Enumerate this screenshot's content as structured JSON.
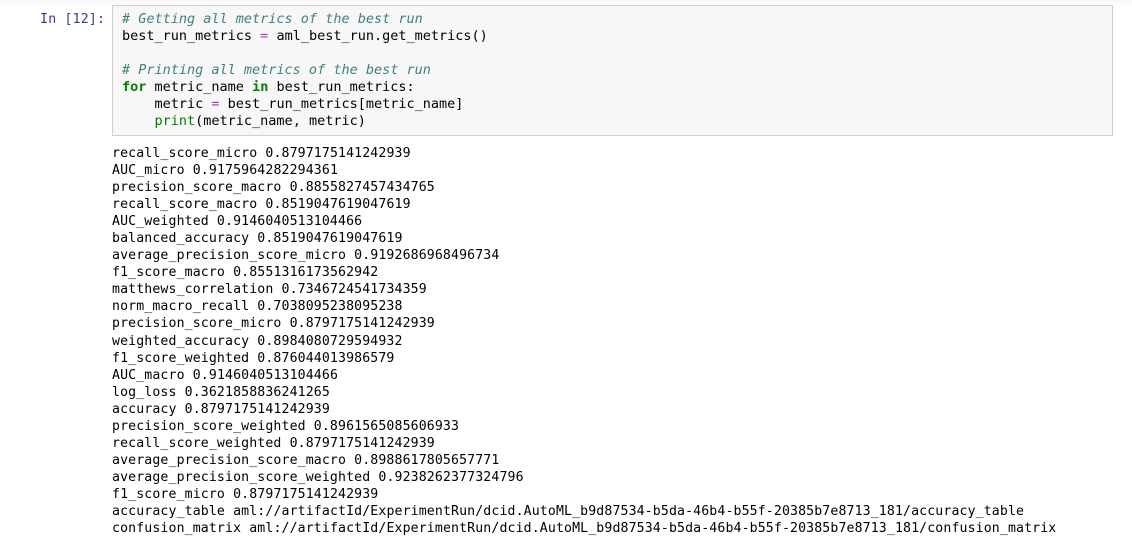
{
  "cell": {
    "prompt_label": "In [12]:",
    "code_lines": [
      [
        {
          "t": "comment",
          "s": "# Getting all metrics of the best run"
        }
      ],
      [
        {
          "t": "plain",
          "s": "best_run_metrics "
        },
        {
          "t": "operator",
          "s": "="
        },
        {
          "t": "plain",
          "s": " aml_best_run.get_metrics()"
        }
      ],
      [
        {
          "t": "plain",
          "s": ""
        }
      ],
      [
        {
          "t": "comment",
          "s": "# Printing all metrics of the best run"
        }
      ],
      [
        {
          "t": "keyword",
          "s": "for"
        },
        {
          "t": "plain",
          "s": " metric_name "
        },
        {
          "t": "keyword",
          "s": "in"
        },
        {
          "t": "plain",
          "s": " best_run_metrics:"
        }
      ],
      [
        {
          "t": "plain",
          "s": "    metric "
        },
        {
          "t": "operator",
          "s": "="
        },
        {
          "t": "plain",
          "s": " best_run_metrics[metric_name]"
        }
      ],
      [
        {
          "t": "plain",
          "s": "    "
        },
        {
          "t": "builtin",
          "s": "print"
        },
        {
          "t": "plain",
          "s": "(metric_name, metric)"
        }
      ]
    ]
  },
  "output": {
    "metrics": [
      {
        "name": "recall_score_micro",
        "value": "0.8797175141242939"
      },
      {
        "name": "AUC_micro",
        "value": "0.9175964282294361"
      },
      {
        "name": "precision_score_macro",
        "value": "0.8855827457434765"
      },
      {
        "name": "recall_score_macro",
        "value": "0.8519047619047619"
      },
      {
        "name": "AUC_weighted",
        "value": "0.9146040513104466"
      },
      {
        "name": "balanced_accuracy",
        "value": "0.8519047619047619"
      },
      {
        "name": "average_precision_score_micro",
        "value": "0.9192686968496734"
      },
      {
        "name": "f1_score_macro",
        "value": "0.8551316173562942"
      },
      {
        "name": "matthews_correlation",
        "value": "0.7346724541734359"
      },
      {
        "name": "norm_macro_recall",
        "value": "0.7038095238095238"
      },
      {
        "name": "precision_score_micro",
        "value": "0.8797175141242939"
      },
      {
        "name": "weighted_accuracy",
        "value": "0.8984080729594932"
      },
      {
        "name": "f1_score_weighted",
        "value": "0.876044013986579"
      },
      {
        "name": "AUC_macro",
        "value": "0.9146040513104466"
      },
      {
        "name": "log_loss",
        "value": "0.3621858836241265"
      },
      {
        "name": "accuracy",
        "value": "0.8797175141242939"
      },
      {
        "name": "precision_score_weighted",
        "value": "0.8961565085606933"
      },
      {
        "name": "recall_score_weighted",
        "value": "0.8797175141242939"
      },
      {
        "name": "average_precision_score_macro",
        "value": "0.8988617805657771"
      },
      {
        "name": "average_precision_score_weighted",
        "value": "0.9238262377324796"
      },
      {
        "name": "f1_score_micro",
        "value": "0.8797175141242939"
      },
      {
        "name": "accuracy_table",
        "value": "aml://artifactId/ExperimentRun/dcid.AutoML_b9d87534-b5da-46b4-b55f-20385b7e8713_181/accuracy_table"
      },
      {
        "name": "confusion_matrix",
        "value": "aml://artifactId/ExperimentRun/dcid.AutoML_b9d87534-b5da-46b4-b55f-20385b7e8713_181/confusion_matrix"
      }
    ]
  },
  "colors": {
    "prompt": "#303f9f",
    "comment": "#408080",
    "keyword": "#008000",
    "operator": "#a2409c",
    "cell_background": "#f7f7f7",
    "cell_border": "#cfcfcf",
    "text": "#000000"
  }
}
